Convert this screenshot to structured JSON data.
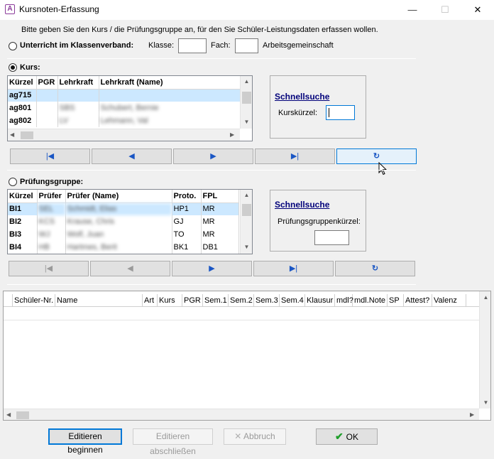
{
  "window": {
    "title": "Kursnoten-Erfassung",
    "icon_letter": "A",
    "minimize": "—",
    "maximize": "☐",
    "close": "✕"
  },
  "intro": "Bitte geben Sie den Kurs / die Prüfungsgruppe an, für den Sie Schüler-Leistungsdaten erfassen wollen.",
  "klassenverband": {
    "radio_label": "Unterricht im Klassenverband:",
    "klasse_label": "Klasse:",
    "fach_label": "Fach:",
    "ag_label": "Arbeitsgemeinschaft"
  },
  "kurs": {
    "radio_label": "Kurs:",
    "columns": [
      "Kürzel",
      "PGR",
      "Lehrkraft",
      "Lehrkraft (Name)"
    ],
    "rows": [
      {
        "kuerzel": "ag715",
        "pgr": "",
        "lehrkraft": "",
        "name": ""
      },
      {
        "kuerzel": "ag801",
        "pgr": "",
        "lehrkraft": "SBS",
        "name": "Schubert, Bernie"
      },
      {
        "kuerzel": "ag802",
        "pgr": "",
        "lehrkraft": "LV",
        "name": "Lehmann, Val"
      }
    ],
    "search": {
      "title": "Schnellsuche",
      "field_label": "Kurskürzel:",
      "value": ""
    }
  },
  "pruefung": {
    "radio_label": "Prüfungsgruppe:",
    "columns": [
      "Kürzel",
      "Prüfer",
      "Prüfer (Name)",
      "Proto.",
      "FPL"
    ],
    "rows": [
      {
        "kuerzel": "BI1",
        "pruefer": "SEL",
        "name": "Schmidt, Elias",
        "proto": "HP1",
        "fpl": "MR"
      },
      {
        "kuerzel": "BI2",
        "pruefer": "KCS",
        "name": "Krause, Chris",
        "proto": "GJ",
        "fpl": "MR"
      },
      {
        "kuerzel": "BI3",
        "pruefer": "WJ",
        "name": "Wolf, Juan",
        "proto": "TO",
        "fpl": "MR"
      },
      {
        "kuerzel": "BI4",
        "pruefer": "HB",
        "name": "Hartmes, Berit",
        "proto": "BK1",
        "fpl": "DB1"
      }
    ],
    "search": {
      "title": "Schnellsuche",
      "field_label": "Prüfungsgruppenkürzel:",
      "value": ""
    }
  },
  "nav_icons": {
    "first": "|◀",
    "prev": "◀",
    "next": "▶",
    "last": "▶|",
    "refresh": "↻"
  },
  "students": {
    "columns": [
      "Schüler-Nr.",
      "Name",
      "Art",
      "Kurs",
      "PGR",
      "Sem.1",
      "Sem.2",
      "Sem.3",
      "Sem.4",
      "Klausur",
      "mdl?",
      "mdl.Note",
      "SP",
      "Attest?",
      "Valenz"
    ]
  },
  "buttons": {
    "edit_start": "Editieren beginnen",
    "edit_stop": "Editieren abschließen",
    "abort": "Abbruch",
    "ok": "OK"
  }
}
